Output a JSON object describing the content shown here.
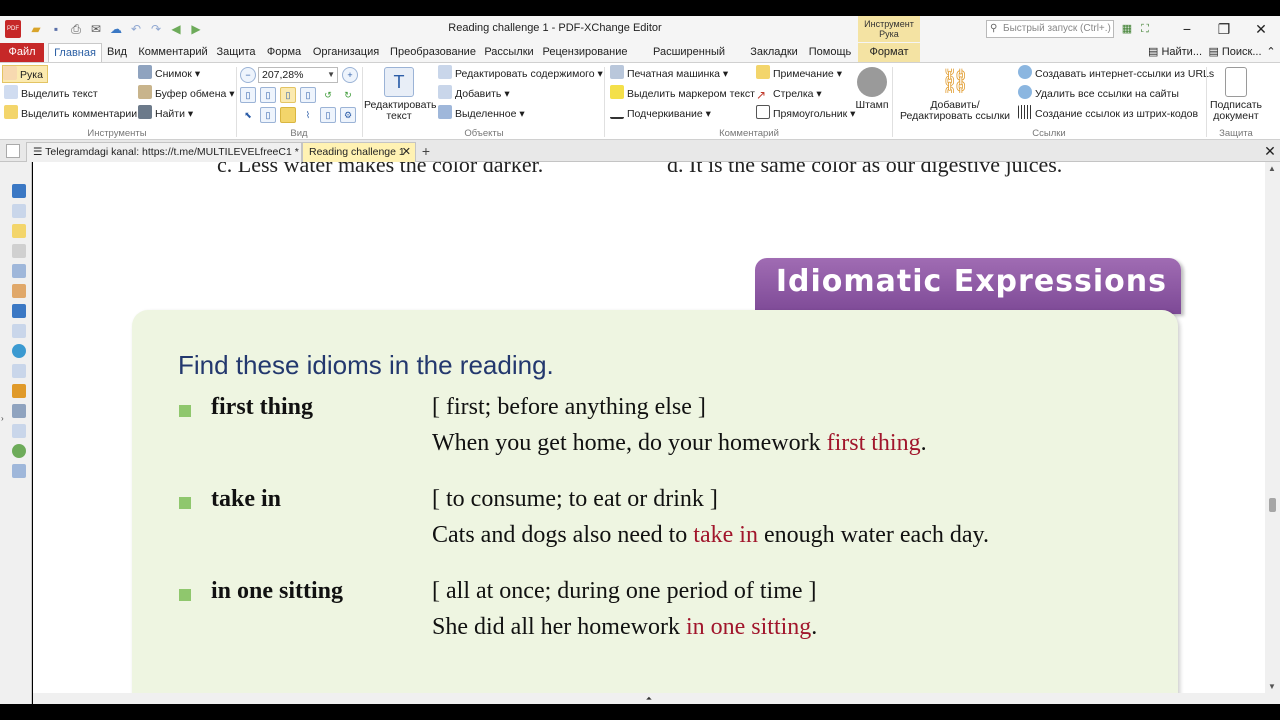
{
  "window": {
    "title": "Reading challenge 1 - PDF-XChange Editor",
    "context_group_label": "Инструмент Рука",
    "search_placeholder": "Быстрый запуск (Ctrl+.)"
  },
  "menu_tabs": [
    "Файл",
    "Главная",
    "Вид",
    "Комментарий",
    "Защита",
    "Форма",
    "Организация",
    "Преобразование",
    "Рассылки",
    "Рецензирование",
    "Расширенный доступ",
    "Закладки",
    "Помощь",
    "Формат"
  ],
  "menu_right": {
    "find": "Найти...",
    "search": "Поиск..."
  },
  "ribbon": {
    "tools": {
      "hand": "Рука",
      "select_text": "Выделить текст",
      "select_comments": "Выделить комментарии",
      "group": "Инструменты"
    },
    "snapshot": {
      "snapshot": "Снимок",
      "clipboard": "Буфер обмена",
      "find": "Найти"
    },
    "view": {
      "zoom": "207,28%",
      "group": "Вид"
    },
    "objects": {
      "edit_text": "Редактировать текст",
      "edit_content": "Редактировать содержимого",
      "add": "Добавить",
      "selected": "Выделенное",
      "group": "Объекты"
    },
    "comment": {
      "typewriter": "Печатная машинка",
      "highlight": "Выделить маркером текст",
      "underline": "Подчеркивание",
      "note": "Примечание",
      "arrow": "Стрелка",
      "rectangle": "Прямоугольник",
      "stamp": "Штамп",
      "group": "Комментарий"
    },
    "links": {
      "add_edit": "Добавить/Редактировать ссылки",
      "create_urls": "Создавать интернет-ссылки из URLs",
      "remove_all": "Удалить все ссылки на сайты",
      "barcode": "Создание ссылок из штрих-кодов",
      "group": "Ссылки"
    },
    "protect": {
      "sign": "Подписать документ",
      "group": "Защита"
    }
  },
  "doc_tabs": [
    {
      "label": "Telegramdagi kanal: https://t.me/MULTILEVELfreeC1 *",
      "active": false
    },
    {
      "label": "Reading challenge 1",
      "active": true
    }
  ],
  "document": {
    "previous_options": {
      "c": "c.   Less water makes the color darker.",
      "d": "d.   It is the same color as our digestive juices."
    },
    "banner": "Idiomatic Expressions",
    "instruction": "Find these idioms in the reading.",
    "idioms": [
      {
        "term": "first thing",
        "definition": "[ first; before anything else ]",
        "example_pre": "When you get home, do your homework ",
        "example_hl": "first thing",
        "example_post": "."
      },
      {
        "term": "take in",
        "definition": "[ to consume; to eat or drink ]",
        "example_pre": "Cats and dogs also need to ",
        "example_hl": "take in",
        "example_post": " enough water each day."
      },
      {
        "term": "in one sitting",
        "definition": "[ all at once; during one period of time ]",
        "example_pre": "She did all her homework ",
        "example_hl": "in one sitting",
        "example_post": "."
      }
    ]
  },
  "colors": {
    "file_tab": "#c62828",
    "banner": "#8e58a6",
    "card_bg": "#eef5e1",
    "title_blue": "#23386e",
    "highlight_red": "#a1162c",
    "bullet_green": "#8fc76d"
  }
}
